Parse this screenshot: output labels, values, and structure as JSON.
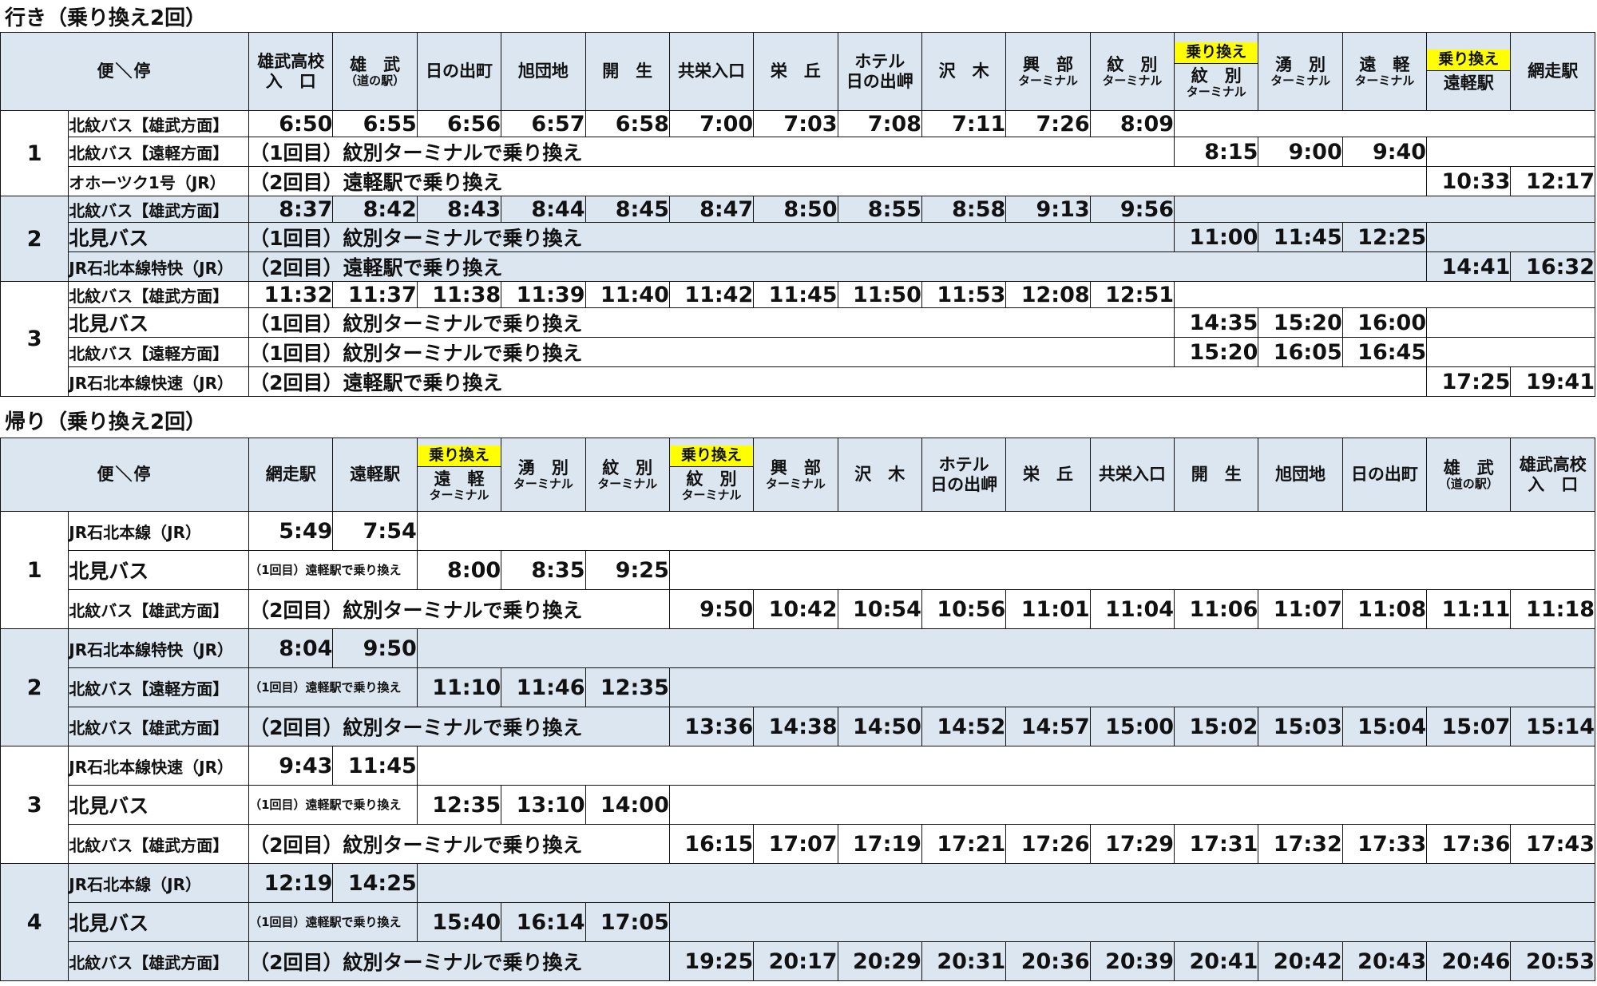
{
  "outbound": {
    "title": "行き（乗り換え2回）",
    "header": {
      "corner": "便＼停",
      "stops": [
        {
          "main": "雄武高校",
          "sub": "入　口",
          "sub_style": "main"
        },
        {
          "main": "雄　武",
          "sub": "（道の駅）"
        },
        {
          "main": "日の出町"
        },
        {
          "main": "旭団地"
        },
        {
          "main": "開　生"
        },
        {
          "main": "共栄入口"
        },
        {
          "main": "栄　丘"
        },
        {
          "main": "ホテル",
          "sub": "日の出岬",
          "sub_style": "main"
        },
        {
          "main": "沢　木"
        },
        {
          "main": "興　部",
          "sub": "ターミナル"
        },
        {
          "main": "紋　別",
          "sub": "ターミナル"
        },
        {
          "xfer": "乗り換え",
          "main": "紋　別",
          "sub": "ターミナル"
        },
        {
          "main": "湧　別",
          "sub": "ターミナル"
        },
        {
          "main": "遠　軽",
          "sub": "ターミナル"
        },
        {
          "xfer": "乗り換え",
          "main": "遠軽駅"
        },
        {
          "main": "網走駅"
        }
      ]
    },
    "trips": [
      {
        "no": "1",
        "rows": [
          {
            "line": "北紋バス【雄武方面】",
            "times": [
              "6:50",
              "6:55",
              "6:56",
              "6:57",
              "6:58",
              "7:00",
              "7:03",
              "7:08",
              "7:11",
              "7:26",
              "8:09"
            ]
          },
          {
            "line": "北紋バス【遠軽方面】",
            "note": "（1回目）紋別ターミナルで乗り換え",
            "times": [
              "8:15",
              "9:00",
              "9:40"
            ]
          },
          {
            "line": "オホーツク1号（JR）",
            "note": "（2回目）遠軽駅で乗り換え",
            "times": [
              "10:33",
              "12:17"
            ]
          }
        ]
      },
      {
        "no": "2",
        "rows": [
          {
            "line": "北紋バス【雄武方面】",
            "times": [
              "8:37",
              "8:42",
              "8:43",
              "8:44",
              "8:45",
              "8:47",
              "8:50",
              "8:55",
              "8:58",
              "9:13",
              "9:56"
            ]
          },
          {
            "line": "北見バス",
            "note": "（1回目）紋別ターミナルで乗り換え",
            "times": [
              "11:00",
              "11:45",
              "12:25"
            ]
          },
          {
            "line": "JR石北本線特快（JR）",
            "note": "（2回目）遠軽駅で乗り換え",
            "times": [
              "14:41",
              "16:32"
            ]
          }
        ]
      },
      {
        "no": "3",
        "rows": [
          {
            "line": "北紋バス【雄武方面】",
            "times": [
              "11:32",
              "11:37",
              "11:38",
              "11:39",
              "11:40",
              "11:42",
              "11:45",
              "11:50",
              "11:53",
              "12:08",
              "12:51"
            ]
          },
          {
            "line": "北見バス",
            "note": "（1回目）紋別ターミナルで乗り換え",
            "times": [
              "14:35",
              "15:20",
              "16:00"
            ]
          },
          {
            "line": "北紋バス【遠軽方面】",
            "note": "（1回目）紋別ターミナルで乗り換え",
            "times": [
              "15:20",
              "16:05",
              "16:45"
            ]
          },
          {
            "line": "JR石北本線快速（JR）",
            "note": "（2回目）遠軽駅で乗り換え",
            "times": [
              "17:25",
              "19:41"
            ]
          }
        ]
      }
    ]
  },
  "inbound": {
    "title": "帰り（乗り換え2回）",
    "header": {
      "corner": "便＼停",
      "stops": [
        {
          "main": "網走駅"
        },
        {
          "main": "遠軽駅"
        },
        {
          "xfer": "乗り換え",
          "main": "遠　軽",
          "sub": "ターミナル"
        },
        {
          "main": "湧　別",
          "sub": "ターミナル"
        },
        {
          "main": "紋　別",
          "sub": "ターミナル"
        },
        {
          "xfer": "乗り換え",
          "main": "紋　別",
          "sub": "ターミナル"
        },
        {
          "main": "興　部",
          "sub": "ターミナル"
        },
        {
          "main": "沢　木"
        },
        {
          "main": "ホテル",
          "sub": "日の出岬",
          "sub_style": "main"
        },
        {
          "main": "栄　丘"
        },
        {
          "main": "共栄入口"
        },
        {
          "main": "開　生"
        },
        {
          "main": "旭団地"
        },
        {
          "main": "日の出町"
        },
        {
          "main": "雄　武",
          "sub": "（道の駅）"
        },
        {
          "main": "雄武高校",
          "sub": "入　口",
          "sub_style": "main"
        }
      ]
    },
    "trips": [
      {
        "no": "1",
        "rows": [
          {
            "line": "JR石北本線（JR）",
            "times": [
              "5:49",
              "7:54"
            ]
          },
          {
            "line": "北見バス",
            "note": "（1回目）遠軽駅で乗り換え",
            "times": [
              "8:00",
              "8:35",
              "9:25"
            ]
          },
          {
            "line": "北紋バス【雄武方面】",
            "note": "（2回目）紋別ターミナルで乗り換え",
            "times": [
              "9:50",
              "10:42",
              "10:54",
              "10:56",
              "11:01",
              "11:04",
              "11:06",
              "11:07",
              "11:08",
              "11:11",
              "11:18"
            ]
          }
        ]
      },
      {
        "no": "2",
        "rows": [
          {
            "line": "JR石北本線特快（JR）",
            "times": [
              "8:04",
              "9:50"
            ]
          },
          {
            "line": "北紋バス【遠軽方面】",
            "note": "（1回目）遠軽駅で乗り換え",
            "times": [
              "11:10",
              "11:46",
              "12:35"
            ]
          },
          {
            "line": "北紋バス【雄武方面】",
            "note": "（2回目）紋別ターミナルで乗り換え",
            "times": [
              "13:36",
              "14:38",
              "14:50",
              "14:52",
              "14:57",
              "15:00",
              "15:02",
              "15:03",
              "15:04",
              "15:07",
              "15:14"
            ]
          }
        ]
      },
      {
        "no": "3",
        "rows": [
          {
            "line": "JR石北本線快速（JR）",
            "times": [
              "9:43",
              "11:45"
            ]
          },
          {
            "line": "北見バス",
            "note": "（1回目）遠軽駅で乗り換え",
            "times": [
              "12:35",
              "13:10",
              "14:00"
            ]
          },
          {
            "line": "北紋バス【雄武方面】",
            "note": "（2回目）紋別ターミナルで乗り換え",
            "times": [
              "16:15",
              "17:07",
              "17:19",
              "17:21",
              "17:26",
              "17:29",
              "17:31",
              "17:32",
              "17:33",
              "17:36",
              "17:43"
            ]
          }
        ]
      },
      {
        "no": "4",
        "rows": [
          {
            "line": "JR石北本線（JR）",
            "times": [
              "12:19",
              "14:25"
            ]
          },
          {
            "line": "北見バス",
            "note": "（1回目）遠軽駅で乗り換え",
            "times": [
              "15:40",
              "16:14",
              "17:05"
            ]
          },
          {
            "line": "北紋バス【雄武方面】",
            "note": "（2回目）紋別ターミナルで乗り換え",
            "times": [
              "19:25",
              "20:17",
              "20:29",
              "20:31",
              "20:36",
              "20:39",
              "20:41",
              "20:42",
              "20:43",
              "20:46",
              "20:53"
            ]
          }
        ]
      }
    ]
  }
}
